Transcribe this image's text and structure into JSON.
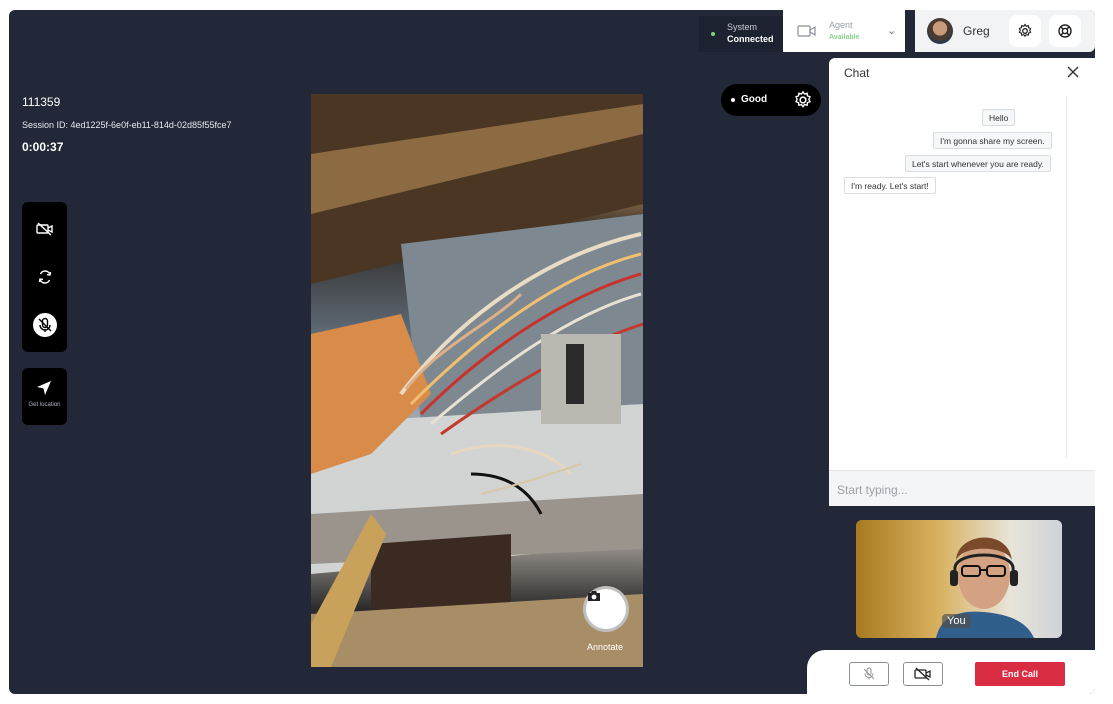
{
  "topbar": {
    "system_label": "System",
    "system_status": "Connected",
    "agent_label": "Agent",
    "agent_status": "Available",
    "user_name": "Greg",
    "icons": [
      "video-camera-icon",
      "chevron-down-icon",
      "settings-gear-icon",
      "help-lifebuoy-icon"
    ]
  },
  "session": {
    "id": "111359",
    "session_id": "Session ID: 4ed1225f-6e0f-eb11-814d-02d85f55fce7",
    "timer": "0:00:37"
  },
  "controls": {
    "icons": [
      "camera-off-icon",
      "switch-camera-icon",
      "mic-off-icon",
      "location-arrow-icon"
    ],
    "location_label": "Get location"
  },
  "video": {
    "annotate_label": "Annotate"
  },
  "signal": {
    "quality": "Good"
  },
  "chat": {
    "title": "Chat",
    "messages": [
      {
        "text": "Hello",
        "side": "right"
      },
      {
        "text": "I'm gonna share my screen.",
        "side": "right"
      },
      {
        "text": "Let's start whenever you are ready.",
        "side": "right"
      },
      {
        "text": "I'm ready. Let's start!",
        "side": "left"
      }
    ],
    "input_placeholder": "Start typing..."
  },
  "self_view": {
    "label": "You"
  },
  "bottom_bar": {
    "end_call_label": "End Call"
  },
  "colors": {
    "background": "#232838",
    "end_call": "#d92d43",
    "status_green": "#7ed081"
  }
}
